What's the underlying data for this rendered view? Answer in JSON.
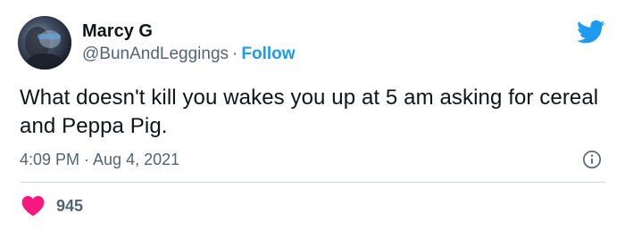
{
  "tweet": {
    "author_name": "Marcy G",
    "handle": "@BunAndLeggings",
    "separator": "·",
    "follow_label": "Follow",
    "text": "What doesn't kill you wakes you up at 5 am asking for cereal and Peppa Pig.",
    "time": "4:09 PM · Aug 4, 2021",
    "like_count": "945"
  },
  "icons": {
    "brand": "twitter-bird-icon",
    "info": "info-icon",
    "like": "heart-icon"
  },
  "colors": {
    "follow_blue": "#1d9bf0",
    "heart_red": "#f91880",
    "secondary_text": "#536471",
    "divider": "#cfd9de"
  }
}
